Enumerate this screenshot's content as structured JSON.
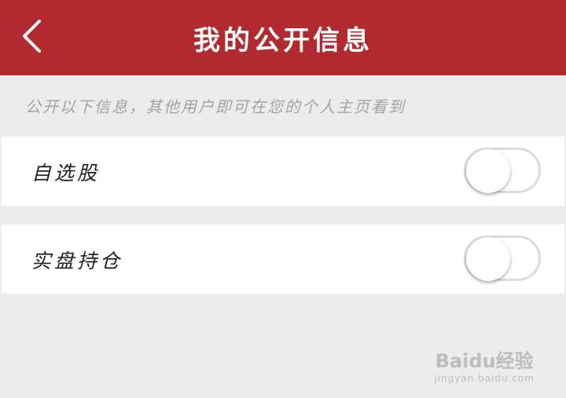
{
  "header": {
    "title": "我的公开信息",
    "back_icon": "chevron-left-icon"
  },
  "hint": "公开以下信息，其他用户即可在您的个人主页看到",
  "settings": [
    {
      "label": "自选股",
      "enabled": false
    },
    {
      "label": "实盘持仓",
      "enabled": false
    }
  ],
  "watermark": {
    "logo": "Baidu经验",
    "url": "jingyan.baidu.com"
  },
  "colors": {
    "header_bg": "#b02a30",
    "page_bg": "#ececec"
  }
}
